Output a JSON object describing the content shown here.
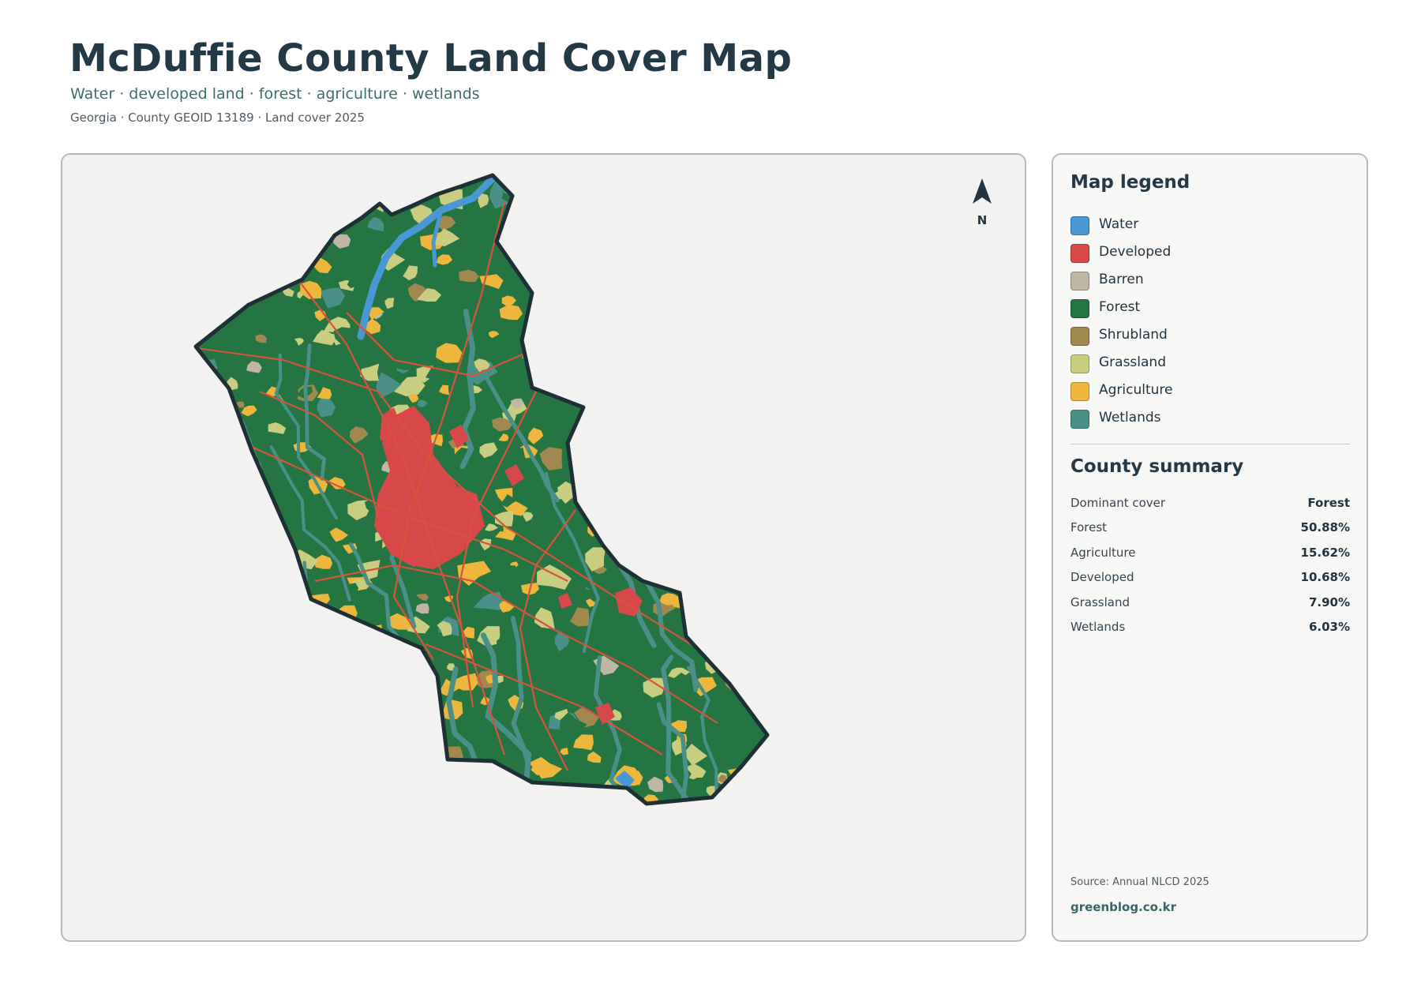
{
  "header": {
    "title": "McDuffie County Land Cover Map",
    "subtitle": "Water · developed land · forest · agriculture · wetlands",
    "meta": "Georgia · County GEOID 13189 · Land cover 2025"
  },
  "map": {
    "north_label": "N",
    "colors": {
      "water": "#4a97d6",
      "developed": "#d94848",
      "barren": "#bfb6a4",
      "forest": "#257543",
      "shrubland": "#a0884f",
      "grassland": "#c9cd7f",
      "agriculture": "#ecb73c",
      "wetlands": "#4a8f88",
      "county_outline": "#1e3036",
      "road": "#d4543c"
    }
  },
  "legend": {
    "title": "Map legend",
    "items": [
      {
        "label": "Water",
        "color": "#4a97d6"
      },
      {
        "label": "Developed",
        "color": "#d94848"
      },
      {
        "label": "Barren",
        "color": "#bfb6a4"
      },
      {
        "label": "Forest",
        "color": "#257543"
      },
      {
        "label": "Shrubland",
        "color": "#a0884f"
      },
      {
        "label": "Grassland",
        "color": "#c9cd7f"
      },
      {
        "label": "Agriculture",
        "color": "#ecb73c"
      },
      {
        "label": "Wetlands",
        "color": "#4a8f88"
      }
    ]
  },
  "summary": {
    "title": "County summary",
    "rows": [
      {
        "key": "Dominant cover",
        "value": "Forest"
      },
      {
        "key": "Forest",
        "value": "50.88%"
      },
      {
        "key": "Agriculture",
        "value": "15.62%"
      },
      {
        "key": "Developed",
        "value": "10.68%"
      },
      {
        "key": "Grassland",
        "value": "7.90%"
      },
      {
        "key": "Wetlands",
        "value": "6.03%"
      }
    ]
  },
  "footer": {
    "source": "Source: Annual NLCD 2025",
    "credit": "greenblog.co.kr"
  }
}
